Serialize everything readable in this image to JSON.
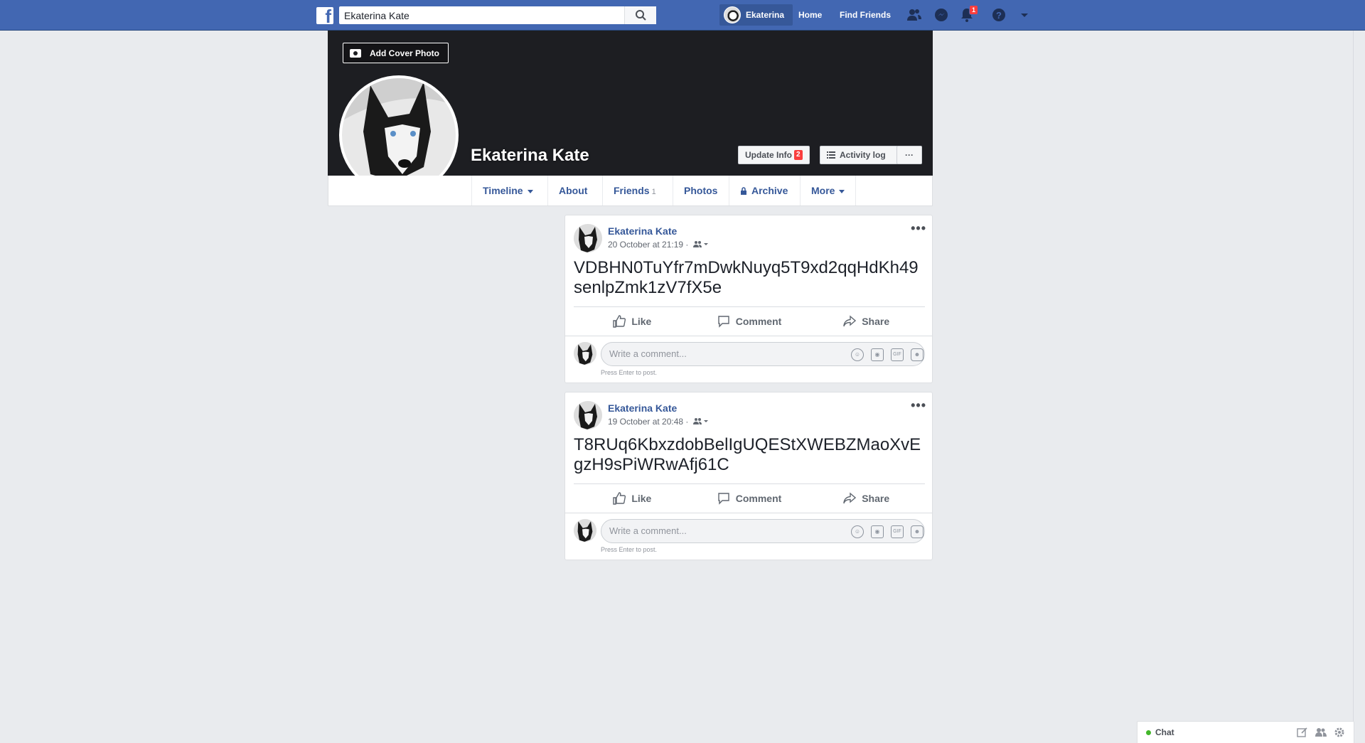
{
  "topbar": {
    "search_value": "Ekaterina Kate",
    "user_short": "Ekaterina",
    "home": "Home",
    "find_friends": "Find Friends",
    "notif_count": "1"
  },
  "profile": {
    "add_cover": "Add Cover Photo",
    "name": "Ekaterina Kate",
    "update_info": "Update Info",
    "update_info_badge": "2",
    "activity_log": "Activity log",
    "more_dots": "···"
  },
  "tabs": {
    "timeline": "Timeline",
    "about": "About",
    "friends": "Friends",
    "friends_count": "1",
    "photos": "Photos",
    "archive": "Archive",
    "more": "More"
  },
  "posts": [
    {
      "author": "Ekaterina Kate",
      "date": "20 October at 21:19 ·",
      "text": "VDBHN0TuYfr7mDwkNuyq5T9xd2qqHdKh49senlpZmk1zV7fX5e"
    },
    {
      "author": "Ekaterina Kate",
      "date": "19 October at 20:48 ·",
      "text": "T8RUq6KbxzdobBelIgUQEStXWEBZMaoXvEgzH9sPiWRwAfj61C"
    }
  ],
  "actions": {
    "like": "Like",
    "comment": "Comment",
    "share": "Share"
  },
  "comment": {
    "placeholder": "Write a comment...",
    "hint": "Press Enter to post.",
    "gif": "GIF"
  },
  "chat": {
    "label": "Chat"
  },
  "colors": {
    "brand": "#4267b2",
    "link": "#365899",
    "cover": "#1d1e22"
  }
}
